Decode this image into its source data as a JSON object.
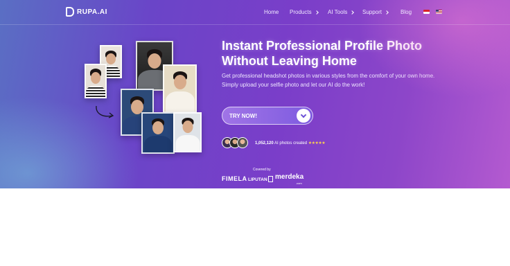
{
  "nav": {
    "brand": "RUPA.AI",
    "links": [
      {
        "label": "Home",
        "dropdown": false
      },
      {
        "label": "Products",
        "dropdown": true
      },
      {
        "label": "AI Tools",
        "dropdown": true
      },
      {
        "label": "Support",
        "dropdown": true
      },
      {
        "label": "Blog",
        "dropdown": false
      }
    ],
    "flags": [
      "indonesia-flag-icon",
      "us-flag-icon"
    ]
  },
  "hero": {
    "headline_line1": "Instant Professional Profile Photo",
    "headline_line2": "Without Leaving Home",
    "subtext": "Get professional headshot photos in various styles from the comfort of your own home. Simply upload your selfie photo and let our AI do the work!",
    "cta_label": "TRY NOW!",
    "proof_count": "1,052,120",
    "proof_text": "AI photos created",
    "stars": "★★★★★",
    "covered_by": "Covered by",
    "press": [
      "FIMELA",
      "LIPUTAN",
      "merdeka",
      ".com"
    ]
  },
  "colors": {
    "accent": "#7e5be0",
    "star": "#ffd34d"
  }
}
